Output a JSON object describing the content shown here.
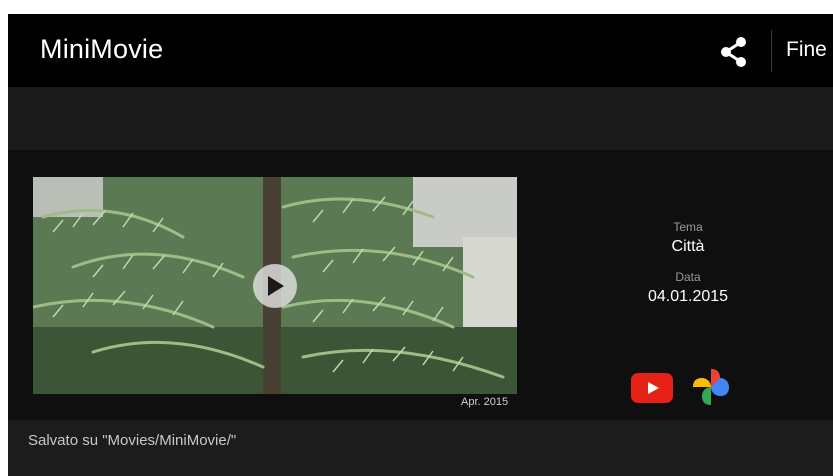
{
  "app": {
    "title": "MiniMovie"
  },
  "toolbar": {
    "share_icon": "share-icon",
    "done_label": "Fine"
  },
  "video": {
    "date_caption": "Apr. 2015",
    "play_icon": "play-icon"
  },
  "info": {
    "theme_label": "Tema",
    "theme_value": "Città",
    "date_label": "Data",
    "date_value": "04.01.2015"
  },
  "share_targets": [
    {
      "name": "youtube",
      "icon": "youtube-icon",
      "color": "#e62117"
    },
    {
      "name": "google-photos",
      "icon": "google-photos-icon"
    }
  ],
  "footer": {
    "saved_text": "Salvato su \"Movies/MiniMovie/\""
  }
}
